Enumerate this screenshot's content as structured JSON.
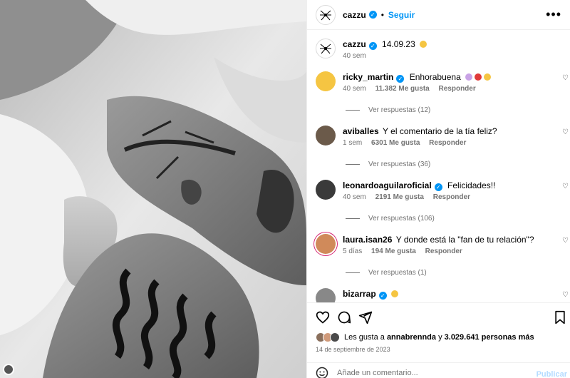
{
  "post": {
    "author": "cazzu",
    "follow_label": "Seguir",
    "more_label": "•••",
    "caption_date": "14.09.23",
    "caption_age": "40 sem"
  },
  "comments": [
    {
      "user": "ricky_martin",
      "text": "Enhorabuena",
      "age": "40 sem",
      "likes": "11.382 Me gusta",
      "reply": "Responder",
      "view_replies": "Ver respuestas (12)",
      "verified": true
    },
    {
      "user": "aviballes",
      "text": "Y el comentario de la tía feliz?",
      "age": "1 sem",
      "likes": "6301 Me gusta",
      "reply": "Responder",
      "view_replies": "Ver respuestas (36)",
      "verified": false
    },
    {
      "user": "leonardoaguilaroficial",
      "text": "Felicidades!!",
      "age": "40 sem",
      "likes": "2191 Me gusta",
      "reply": "Responder",
      "view_replies": "Ver respuestas (106)",
      "verified": true
    },
    {
      "user": "laura.isan26",
      "text": "Y donde está la \"fan de tu relación\"?",
      "age": "5 días",
      "likes": "194 Me gusta",
      "reply": "Responder",
      "view_replies": "Ver respuestas (1)",
      "verified": false
    },
    {
      "user": "bizarrap",
      "text": "",
      "age": "",
      "likes": "",
      "reply": "",
      "view_replies": "",
      "verified": true
    }
  ],
  "likes_bar": {
    "prefix": "Les gusta a",
    "first_user": "annabrennda",
    "middle": "y",
    "count": "3.029.641 personas más"
  },
  "date_full": "14 de septiembre de 2023",
  "add_comment": {
    "placeholder": "Añade un comentario...",
    "publish": "Publicar"
  },
  "icons": {
    "more": "more-options-icon",
    "heart": "heart-icon",
    "comment": "comment-icon",
    "share": "share-icon",
    "save": "bookmark-icon",
    "emoji": "emoji-icon",
    "verified": "verified-badge-icon"
  },
  "colors": {
    "accent": "#0095f6",
    "muted": "#737373",
    "border": "#efefef"
  }
}
